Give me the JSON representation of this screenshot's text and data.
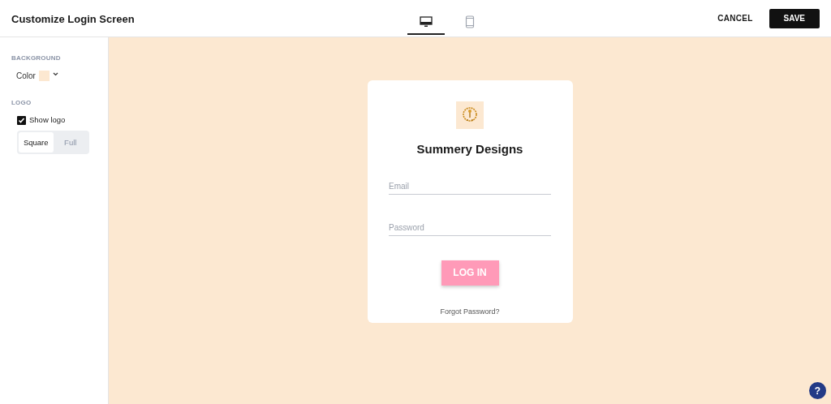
{
  "header": {
    "title": "Customize Login Screen",
    "device_tabs": [
      {
        "kind": "desktop",
        "selected": true
      },
      {
        "kind": "mobile",
        "selected": false
      }
    ],
    "cancel": "CANCEL",
    "save": "SAVE"
  },
  "sidebar": {
    "background_heading": "BACKGROUND",
    "color_label": "Color",
    "color": "#fce8d1",
    "logo_heading": "LOGO",
    "show_logo": {
      "label": "Show logo",
      "checked": true
    },
    "logo_styles": [
      {
        "label": "Square",
        "selected": true
      },
      {
        "label": "Full",
        "selected": false
      }
    ]
  },
  "login_card": {
    "title": "Summery Designs",
    "fields": [
      {
        "placeholder": "Email"
      },
      {
        "placeholder": "Password"
      }
    ],
    "login_button": "LOG IN",
    "forgot_link": "Forgot Password?"
  },
  "help_button": "?"
}
